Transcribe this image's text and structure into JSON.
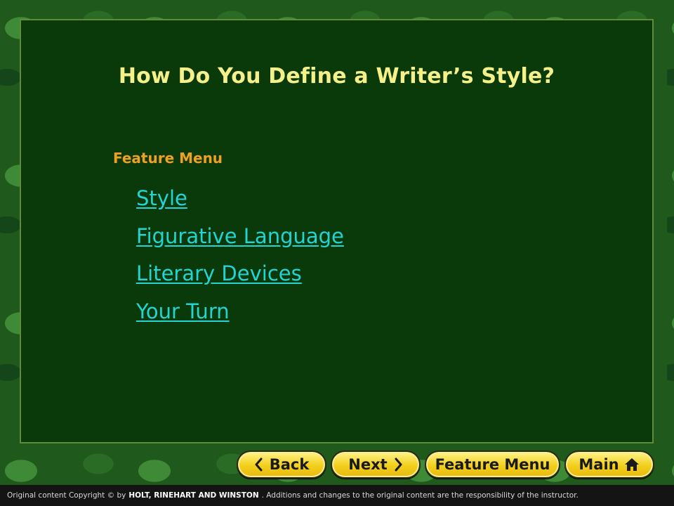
{
  "slide": {
    "title": "How Do You Define a Writer’s Style?",
    "subtitle": "Feature Menu"
  },
  "menu": {
    "items": [
      {
        "label": "Style"
      },
      {
        "label": "Figurative Language"
      },
      {
        "label": "Literary Devices"
      },
      {
        "label": "Your Turn"
      }
    ]
  },
  "nav": {
    "back_label": "Back",
    "next_label": "Next",
    "feature_label": "Feature Menu",
    "main_label": "Main"
  },
  "footer": {
    "prefix": "Original content Copyright © by",
    "brand": "HOLT, RINEHART AND WINSTON",
    "suffix": ". Additions and changes to the original content are the responsibility of the instructor."
  },
  "colors": {
    "title": "#f6f08a",
    "subtitle": "#f0a020",
    "link": "#22d4d4",
    "panel": "#0b3a0a",
    "button": "#f2cf1c"
  },
  "icons": {
    "back": "chevron-left-icon",
    "next": "chevron-right-icon",
    "main": "home-icon"
  }
}
